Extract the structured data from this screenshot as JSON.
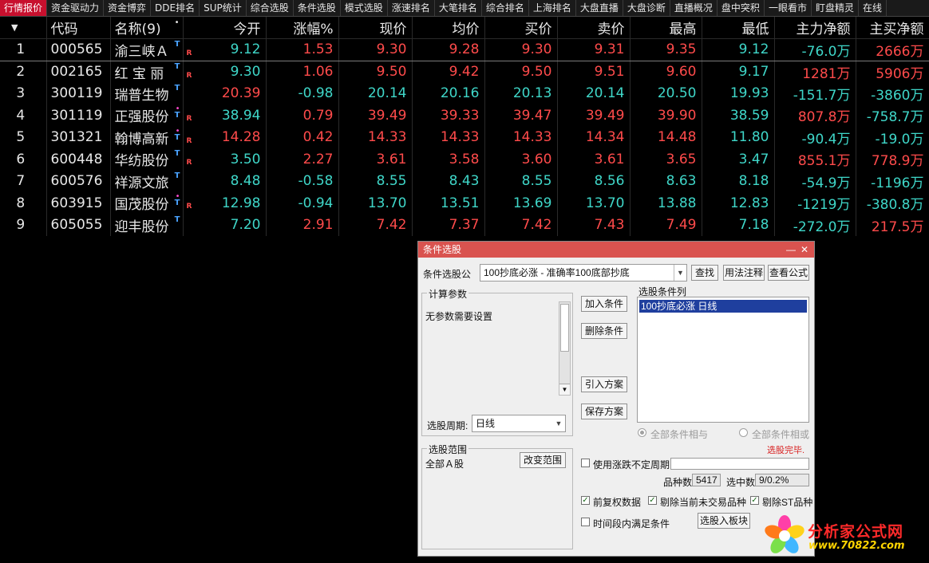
{
  "tabs": [
    "行情报价",
    "资金驱动力",
    "资金博弈",
    "DDE排名",
    "SUP统计",
    "综合选股",
    "条件选股",
    "模式选股",
    "涨速排名",
    "大笔排名",
    "综合排名",
    "上海排名",
    "大盘直播",
    "大盘诊断",
    "直播概况",
    "盘中突积",
    "一眼看市",
    "盯盘精灵",
    "在线"
  ],
  "table": {
    "headers": {
      "sort": "▼",
      "code": "代码",
      "name": "名称(9)",
      "name_dot": "•",
      "open": "今开",
      "chg": "涨幅%",
      "price": "现价",
      "avg": "均价",
      "bid": "买价",
      "ask": "卖价",
      "high": "最高",
      "low": "最低",
      "main_net": "主力净额",
      "main_buy": "主买净额"
    },
    "rows": [
      {
        "idx": "1",
        "code": "000565",
        "name": "渝三峡Ａ",
        "open": "9.12",
        "chg": "1.53",
        "price": "9.30",
        "avg": "9.28",
        "bid": "9.30",
        "ask": "9.31",
        "high": "9.35",
        "low": "9.12",
        "main_net": "-76.0万",
        "main_buy": "2666万"
      },
      {
        "idx": "2",
        "code": "002165",
        "name": "红 宝 丽",
        "open": "9.30",
        "chg": "1.06",
        "price": "9.50",
        "avg": "9.42",
        "bid": "9.50",
        "ask": "9.51",
        "high": "9.60",
        "low": "9.17",
        "main_net": "1281万",
        "main_buy": "5906万"
      },
      {
        "idx": "3",
        "code": "300119",
        "name": "瑞普生物",
        "open": "20.39",
        "chg": "-0.98",
        "price": "20.14",
        "avg": "20.16",
        "bid": "20.13",
        "ask": "20.14",
        "high": "20.50",
        "low": "19.93",
        "main_net": "-151.7万",
        "main_buy": "-3860万"
      },
      {
        "idx": "4",
        "code": "301119",
        "name": "正强股份",
        "open": "38.94",
        "chg": "0.79",
        "price": "39.49",
        "avg": "39.33",
        "bid": "39.47",
        "ask": "39.49",
        "high": "39.90",
        "low": "38.59",
        "main_net": "807.8万",
        "main_buy": "-758.7万"
      },
      {
        "idx": "5",
        "code": "301321",
        "name": "翰博高新",
        "open": "14.28",
        "chg": "0.42",
        "price": "14.33",
        "avg": "14.33",
        "bid": "14.33",
        "ask": "14.34",
        "high": "14.48",
        "low": "11.80",
        "main_net": "-90.4万",
        "main_buy": "-19.0万"
      },
      {
        "idx": "6",
        "code": "600448",
        "name": "华纺股份",
        "open": "3.50",
        "chg": "2.27",
        "price": "3.61",
        "avg": "3.58",
        "bid": "3.60",
        "ask": "3.61",
        "high": "3.65",
        "low": "3.47",
        "main_net": "855.1万",
        "main_buy": "778.9万"
      },
      {
        "idx": "7",
        "code": "600576",
        "name": "祥源文旅",
        "open": "8.48",
        "chg": "-0.58",
        "price": "8.55",
        "avg": "8.43",
        "bid": "8.55",
        "ask": "8.56",
        "high": "8.63",
        "low": "8.18",
        "main_net": "-54.9万",
        "main_buy": "-1196万"
      },
      {
        "idx": "8",
        "code": "603915",
        "name": "国茂股份",
        "open": "12.98",
        "chg": "-0.94",
        "price": "13.70",
        "avg": "13.51",
        "bid": "13.69",
        "ask": "13.70",
        "high": "13.88",
        "low": "12.83",
        "main_net": "-1219万",
        "main_buy": "-380.8万"
      },
      {
        "idx": "9",
        "code": "605055",
        "name": "迎丰股份",
        "open": "7.20",
        "chg": "2.91",
        "price": "7.42",
        "avg": "7.37",
        "bid": "7.42",
        "ask": "7.43",
        "high": "7.49",
        "low": "7.18",
        "main_net": "-272.0万",
        "main_buy": "217.5万"
      }
    ],
    "marks": {
      "t": "T",
      "r": "R",
      "dot": "•"
    },
    "colors": {
      "up": "#ff4b4b",
      "down": "#3fd7c9",
      "flat": "#e8e8e8"
    }
  },
  "dialog": {
    "title": "条件选股",
    "min": "—",
    "close": "✕",
    "formula_label": "条件选股公",
    "formula_value": "100抄底必涨  -  准确率100底部抄底",
    "btn_find": "查找",
    "btn_usage": "用法注释",
    "btn_view": "查看公式",
    "params_group": "计算参数",
    "params_text": "无参数需要设置",
    "period_label": "选股周期:",
    "period_value": "日线",
    "btn_add": "加入条件",
    "btn_delete": "删除条件",
    "btn_import": "引入方案",
    "btn_save": "保存方案",
    "conditions_label": "选股条件列",
    "conditions": [
      "100抄底必涨  日线"
    ],
    "radio_and": "全部条件相与",
    "radio_or": "全部条件相或",
    "status": "选股完毕.",
    "range_group": "选股范围",
    "range_value": "全部Ａ股",
    "btn_range": "改变范围",
    "use_period_label": "使用涨跌不定周期",
    "count_label": "品种数",
    "count_value": "5417",
    "hit_label": "选中数",
    "hit_value": "9/0.2%",
    "chk_fq": "前复权数据",
    "chk_suspend": "剔除当前未交易品种",
    "chk_st": "剔除ST品种",
    "chk_timeframe": "时间段内满足条件",
    "btn_to_block": "选股入板块"
  },
  "watermark": {
    "name": "分析家公式网",
    "url": "www.70822.com"
  }
}
